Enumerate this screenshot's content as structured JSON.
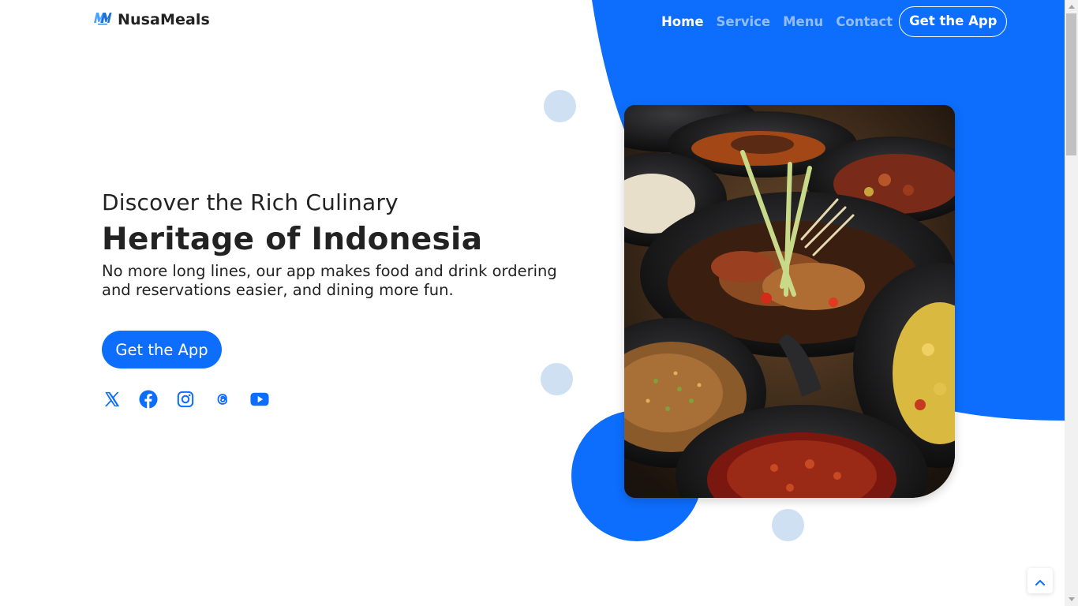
{
  "brand": {
    "name": "NusaMeals",
    "logo_text": "NM",
    "logo_icon": "nusameals-logo"
  },
  "nav": {
    "items": [
      {
        "label": "Home",
        "active": true
      },
      {
        "label": "Service",
        "active": false
      },
      {
        "label": "Menu",
        "active": false
      },
      {
        "label": "Contact",
        "active": false
      }
    ],
    "cta_label": "Get the App"
  },
  "hero": {
    "subtitle": "Discover the Rich Culinary",
    "title": "Heritage of Indonesia",
    "description": "No more long lines, our app makes food and drink ordering and reservations easier, and dining more fun.",
    "button_label": "Get the App"
  },
  "socials": [
    {
      "icon": "x-twitter-icon"
    },
    {
      "icon": "facebook-icon"
    },
    {
      "icon": "instagram-icon"
    },
    {
      "icon": "threads-icon"
    },
    {
      "icon": "youtube-icon"
    }
  ],
  "colors": {
    "primary": "#0d6efd",
    "accent_light": "#cfe0f3",
    "text": "#222222",
    "background": "#ffffff"
  },
  "image": {
    "icon": "food-photo"
  }
}
